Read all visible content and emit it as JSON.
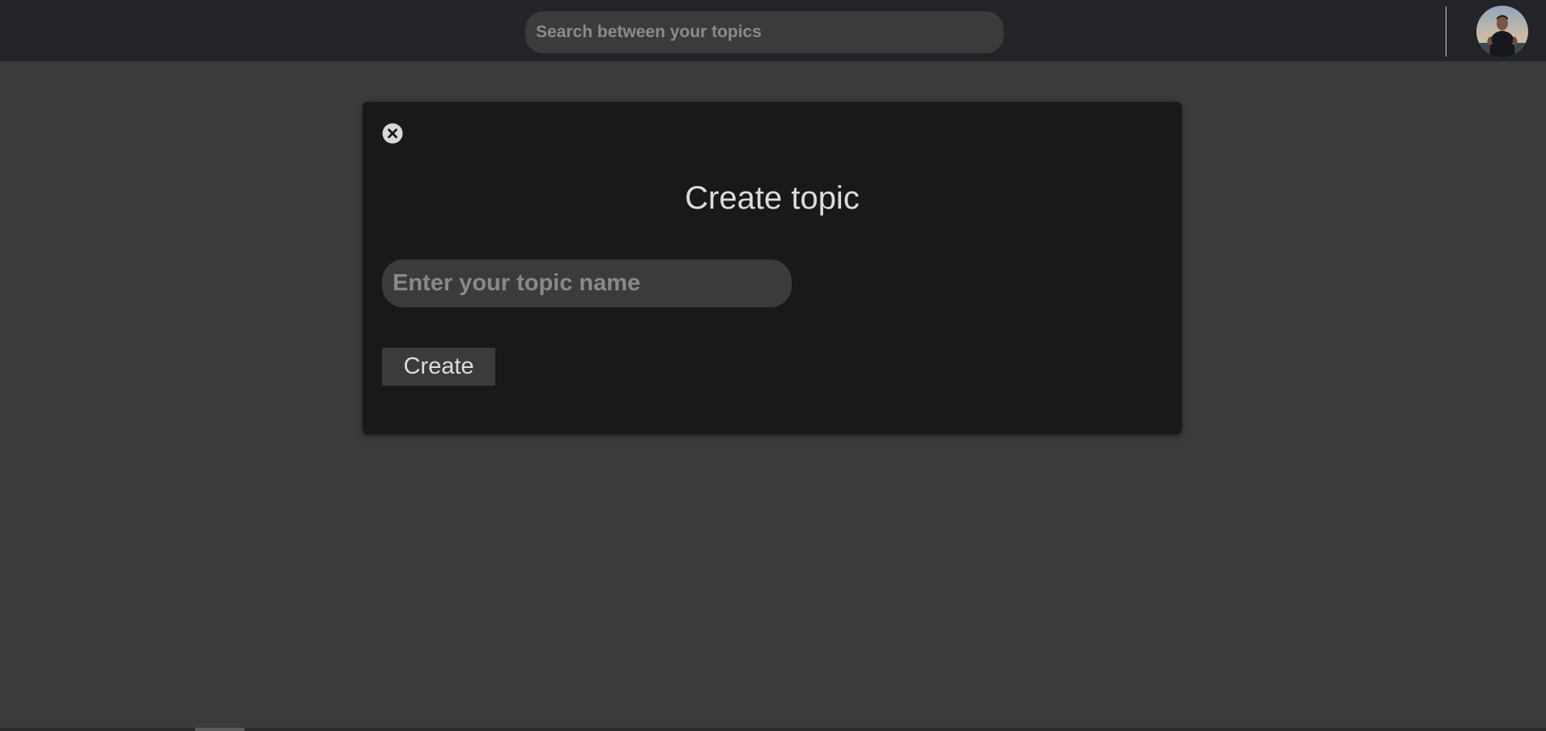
{
  "header": {
    "search_placeholder": "Search between your topics",
    "avatar_icon": "user-avatar"
  },
  "modal": {
    "close_icon": "close-circle-icon",
    "title": "Create topic",
    "topic_input_placeholder": "Enter your topic name",
    "topic_input_value": "",
    "create_label": "Create"
  },
  "colors": {
    "page_background": "#3a3b3d",
    "header_background": "#232427",
    "modal_background": "#19191b",
    "text": "#dcdcdc",
    "placeholder": "#88898b"
  }
}
